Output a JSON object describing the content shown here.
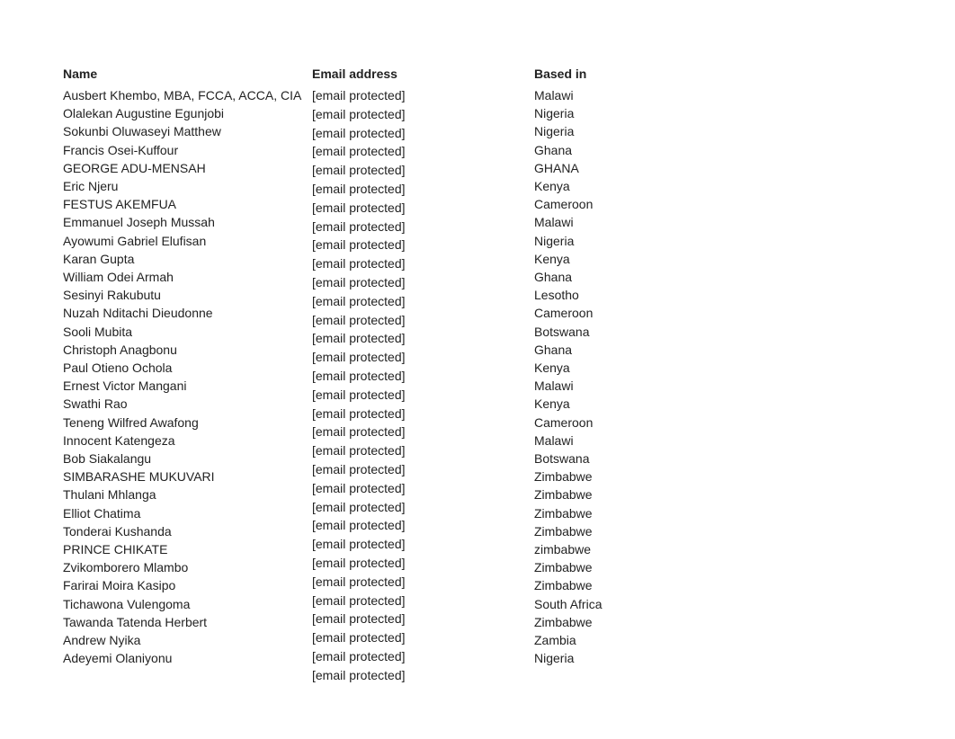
{
  "headers": {
    "name": "Name",
    "email": "Email address",
    "based": "Based in"
  },
  "email_placeholder": "[email protected]",
  "rows": [
    {
      "name": "Ausbert Khembo, MBA, FCCA, ACCA, CIA",
      "based": "Malawi"
    },
    {
      "name": "Olalekan Augustine Egunjobi",
      "based": "Nigeria"
    },
    {
      "name": "Sokunbi Oluwaseyi Matthew",
      "based": "Nigeria"
    },
    {
      "name": "Francis Osei-Kuffour",
      "based": "Ghana"
    },
    {
      "name": "GEORGE ADU-MENSAH",
      "based": "GHANA"
    },
    {
      "name": "Eric Njeru",
      "based": "Kenya"
    },
    {
      "name": "FESTUS AKEMFUA",
      "based": "Cameroon"
    },
    {
      "name": "Emmanuel Joseph Mussah",
      "based": "Malawi"
    },
    {
      "name": "Ayowumi Gabriel Elufisan",
      "based": "Nigeria"
    },
    {
      "name": "Karan Gupta",
      "based": "Kenya"
    },
    {
      "name": "William Odei Armah",
      "based": "Ghana"
    },
    {
      "name": "Sesinyi Rakubutu",
      "based": "Lesotho"
    },
    {
      "name": "Nuzah Nditachi Dieudonne",
      "based": "Cameroon"
    },
    {
      "name": "Sooli Mubita",
      "based": "Botswana"
    },
    {
      "name": "Christoph Anagbonu",
      "based": "Ghana"
    },
    {
      "name": "Paul Otieno Ochola",
      "based": "Kenya"
    },
    {
      "name": "Ernest Victor Mangani",
      "based": "Malawi"
    },
    {
      "name": "Swathi Rao",
      "based": "Kenya"
    },
    {
      "name": "Teneng Wilfred Awafong",
      "based": "Cameroon"
    },
    {
      "name": "Innocent Katengeza",
      "based": "Malawi"
    },
    {
      "name": "Bob Siakalangu",
      "based": "Botswana"
    },
    {
      "name": "SIMBARASHE MUKUVARI",
      "based": "Zimbabwe"
    },
    {
      "name": "Thulani Mhlanga",
      "based": "Zimbabwe"
    },
    {
      "name": "Elliot Chatima",
      "based": "Zimbabwe"
    },
    {
      "name": "Tonderai Kushanda",
      "based": "Zimbabwe"
    },
    {
      "name": "PRINCE CHIKATE",
      "based": "zimbabwe"
    },
    {
      "name": "Zvikomborero Mlambo",
      "based": "Zimbabwe"
    },
    {
      "name": "Farirai Moira Kasipo",
      "based": "Zimbabwe"
    },
    {
      "name": "Tichawona Vulengoma",
      "based": "South Africa"
    },
    {
      "name": "Tawanda Tatenda Herbert",
      "based": "Zimbabwe"
    },
    {
      "name": "Andrew Nyika",
      "based": "Zambia"
    },
    {
      "name": "Adeyemi Olaniyonu",
      "based": "Nigeria"
    }
  ]
}
